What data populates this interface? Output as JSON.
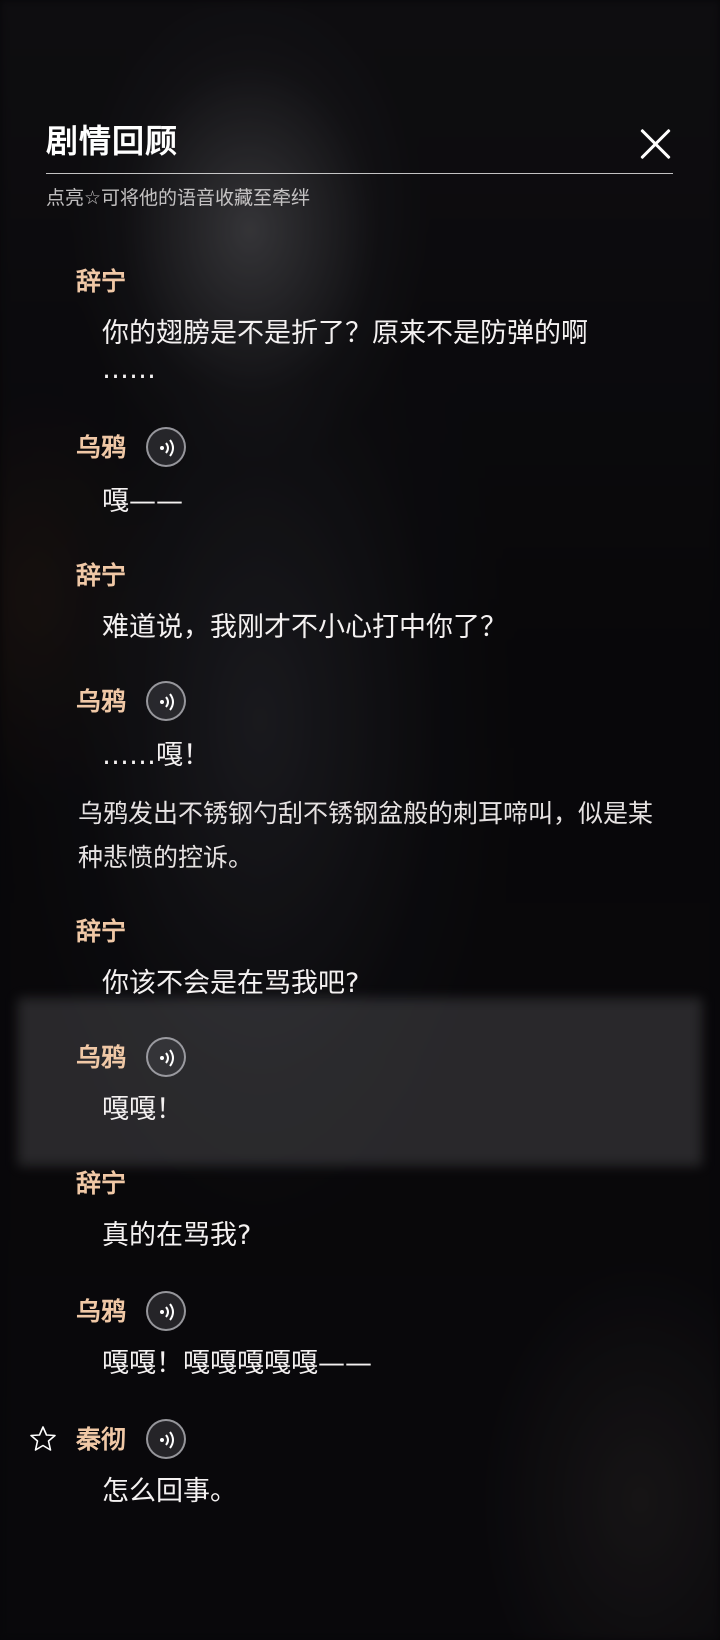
{
  "header": {
    "title": "剧情回顾",
    "hint": "点亮☆可将他的语音收藏至牵绊"
  },
  "dialogue": [
    {
      "speaker": "辞宁",
      "line": "你的翅膀是不是折了？原来不是防弹的啊",
      "line2": "……"
    },
    {
      "speaker": "乌鸦",
      "line": "嘎——",
      "has_voice": true
    },
    {
      "speaker": "辞宁",
      "line": "难道说，我刚才不小心打中你了？"
    },
    {
      "speaker": "乌鸦",
      "line": "……嘎！",
      "has_voice": true
    },
    {
      "narration": "乌鸦发出不锈钢勺刮不锈钢盆般的刺耳啼叫，似是某种悲愤的控诉。"
    },
    {
      "speaker": "辞宁",
      "line": "你该不会是在骂我吧?"
    },
    {
      "speaker": "乌鸦",
      "line": "嘎嘎！",
      "has_voice": true,
      "highlighted": true
    },
    {
      "speaker": "辞宁",
      "line": "真的在骂我?"
    },
    {
      "speaker": "乌鸦",
      "line": "嘎嘎！嘎嘎嘎嘎嘎——",
      "has_voice": true
    },
    {
      "speaker": "秦彻",
      "line": "怎么回事。",
      "has_voice": true,
      "has_star": true
    }
  ],
  "colors": {
    "speaker": "#f0c8a6",
    "text": "#f4f1f1",
    "background": "#0b0a0d"
  },
  "icons": {
    "close": "close-icon",
    "voice": "voice-play-icon",
    "favorite": "star-outline-icon"
  }
}
